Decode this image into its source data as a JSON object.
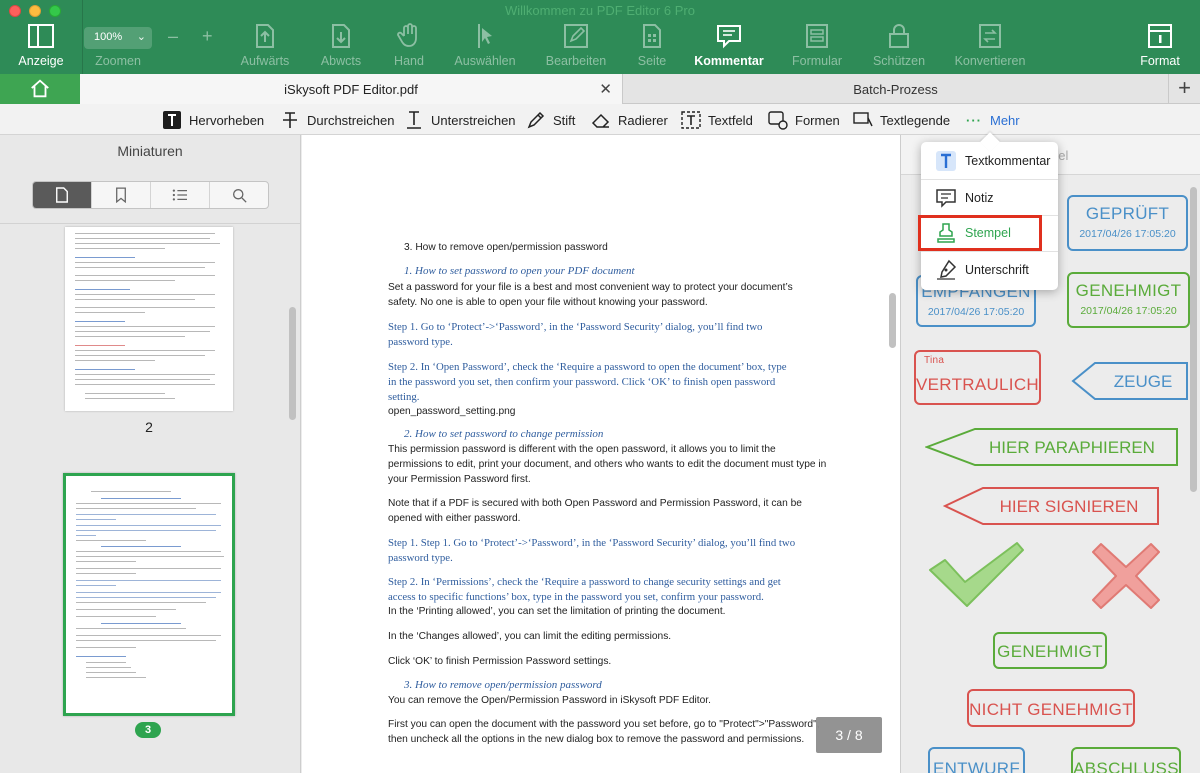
{
  "window": {
    "title": "Willkommen zu PDF Editor 6 Pro"
  },
  "toolbar": {
    "anzeige": "Anzeige",
    "zoom_value": "100%",
    "zoom_label": "Zoomen",
    "zoom_minus": "–",
    "zoom_plus": "+",
    "aufwaerts": "Aufwärts",
    "abwaerts": "Abwcts",
    "hand": "Hand",
    "auswaehlen": "Auswählen",
    "bearbeiten": "Bearbeiten",
    "seite": "Seite",
    "kommentar": "Kommentar",
    "formular": "Formular",
    "schuetzen": "Schützen",
    "konvertieren": "Konvertieren",
    "format": "Format"
  },
  "tabs": {
    "document": "iSkysoft PDF Editor.pdf",
    "close": "✕",
    "batch": "Batch-Prozess",
    "add": "+"
  },
  "annotation_tools": {
    "hervorheben": "Hervorheben",
    "durchstreichen": "Durchstreichen",
    "unterstreichen": "Unterstreichen",
    "stift": "Stift",
    "radierer": "Radierer",
    "textfeld": "Textfeld",
    "formen": "Formen",
    "textlegende": "Textlegende",
    "mehr_dots": "···",
    "mehr": "Mehr"
  },
  "sidebar": {
    "title": "Miniaturen",
    "page_2_label": "2",
    "page_3_label": "3"
  },
  "document": {
    "lines": [
      {
        "text": "3.    How to remove open/permission password",
        "style": "plain",
        "indent": 16
      },
      {
        "text": "1.          How to set password to open your PDF document",
        "style": "italic",
        "indent": 16
      },
      {
        "text": "Set a password for your file is a best and most convenient way to protect your document’s",
        "style": "plain",
        "indent": 0
      },
      {
        "text": "safety. No one is able to open your file without knowing your password.",
        "style": "plain",
        "indent": 0
      },
      {
        "text": "Step 1. Go to ‘Protect’->‘Password’, in the ‘Password Security’ dialog, you’ll find two",
        "style": "serif",
        "indent": 0
      },
      {
        "text": "password type.",
        "style": "serif",
        "indent": 0
      },
      {
        "text": "Step 2. In ‘Open Password’, check the ‘Require a password to open the document’ box, type",
        "style": "serif",
        "indent": 0
      },
      {
        "text": "in the password you set, then confirm your password. Click ‘OK’ to finish open password",
        "style": "serif",
        "indent": 0
      },
      {
        "text": "setting.",
        "style": "serif",
        "indent": 0
      },
      {
        "text": "open_password_setting.png",
        "style": "plain",
        "indent": 0
      },
      {
        "text": "2.          How to set password to change permission",
        "style": "italic",
        "indent": 16
      },
      {
        "text": "This permission password is different with the open password, it allows you to limit the",
        "style": "plain",
        "indent": 0
      },
      {
        "text": "permissions to edit, print your document, and others who wants to edit the document must type in",
        "style": "plain",
        "indent": 0
      },
      {
        "text": "your Permission Password first.",
        "style": "plain",
        "indent": 0
      },
      {
        "text": "Note that if a PDF is secured with both Open Password and Permission Password, it can be",
        "style": "plain",
        "indent": 0
      },
      {
        "text": "opened with either password.",
        "style": "plain",
        "indent": 0
      },
      {
        "text": "Step 1. Step 1. Go to ‘Protect’->‘Password’, in the ‘Password Security’ dialog, you’ll find two",
        "style": "serif",
        "indent": 0
      },
      {
        "text": "password type.",
        "style": "serif",
        "indent": 0
      },
      {
        "text": "Step 2. In ‘Permissions’, check the ‘Require a password to change security settings and get",
        "style": "serif",
        "indent": 0
      },
      {
        "text": "access to specific functions’ box, type in the password you set, confirm your password.",
        "style": "serif",
        "indent": 0
      },
      {
        "text": "In the ‘Printing allowed’, you can set the limitation of printing the document.",
        "style": "plain",
        "indent": 0
      },
      {
        "text": "In the ‘Changes allowed’, you can limit the editing permissions.",
        "style": "plain",
        "indent": 0
      },
      {
        "text": "Click ‘OK’ to finish Permission Password settings.",
        "style": "plain",
        "indent": 0
      },
      {
        "text": "3.          How to remove open/permission password",
        "style": "italic",
        "indent": 16
      },
      {
        "text": "You can remove the Open/Permission Password in iSkysoft PDF Editor.",
        "style": "plain",
        "indent": 0
      },
      {
        "text": "First you can open the document with the password you set before, go to \"Protect\">\"Password\",",
        "style": "plain",
        "indent": 0
      },
      {
        "text": "then uncheck all the options in the new dialog box to remove the password and permissions.",
        "style": "plain",
        "indent": 0
      }
    ],
    "page_indicator": "3 / 8"
  },
  "stamp_panel": {
    "header_partial": "pel",
    "stamps": [
      {
        "id": "geprueft",
        "label": "GEPRÜFT",
        "date": "2017/04/26 17:05:20",
        "color": "#4a90c8"
      },
      {
        "id": "empfangen",
        "label": "EMPFANGEN",
        "date": "2017/04/26 17:05:20",
        "color": "#4a90c8"
      },
      {
        "id": "genehmigt-dated",
        "label": "GENEHMIGT",
        "date": "2017/04/26 17:05:20",
        "color": "#5aab3a"
      },
      {
        "id": "vertraulich",
        "label": "VERTRAULICH",
        "tag": "Tina",
        "color": "#d9534f"
      },
      {
        "id": "zeuge",
        "label": "ZEUGE",
        "color": "#4a90c8"
      },
      {
        "id": "hier-paraphieren",
        "label": "HIER PARAPHIEREN",
        "color": "#5aab3a"
      },
      {
        "id": "hier-signieren",
        "label": "HIER SIGNIEREN",
        "color": "#d9534f"
      },
      {
        "id": "genehmigt",
        "label": "GENEHMIGT",
        "color": "#5aab3a"
      },
      {
        "id": "nicht-genehmigt",
        "label": "NICHT GENEHMIGT",
        "color": "#d9534f"
      },
      {
        "id": "entwurf",
        "label": "ENTWURF",
        "color": "#4a90c8"
      },
      {
        "id": "abschluss",
        "label": "ABSCHLUSS",
        "color": "#5aab3a"
      }
    ]
  },
  "more_menu": {
    "textkommentar": "Textkommentar",
    "notiz": "Notiz",
    "stempel": "Stempel",
    "unterschrift": "Unterschrift"
  },
  "colors": {
    "toolbar_green": "#2e8b57",
    "accent_green": "#2ea44f",
    "highlight_red": "#e0301e",
    "link_blue": "#2a6fd4"
  }
}
